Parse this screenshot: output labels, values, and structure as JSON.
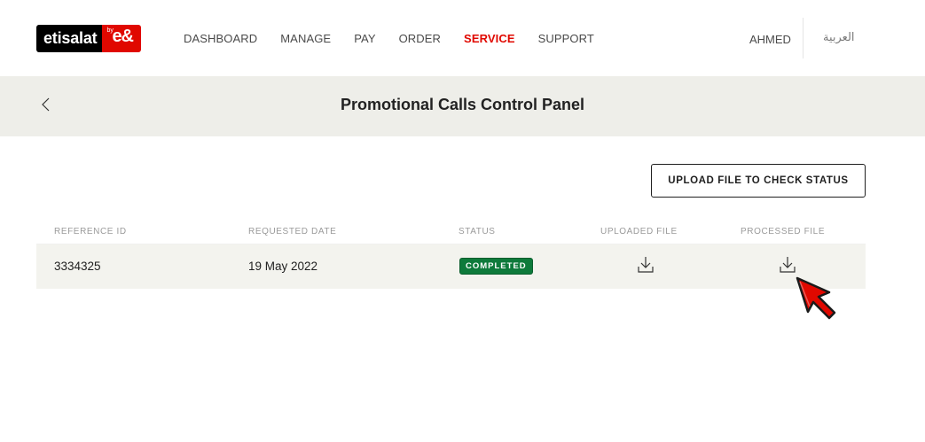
{
  "brand": {
    "name": "etisalat",
    "by": "by",
    "eand": "e&",
    "colors": {
      "red": "#e00800",
      "black": "#000000"
    }
  },
  "nav": {
    "items": [
      {
        "label": "DASHBOARD",
        "active": false
      },
      {
        "label": "MANAGE",
        "active": false
      },
      {
        "label": "PAY",
        "active": false
      },
      {
        "label": "ORDER",
        "active": false
      },
      {
        "label": "SERVICE",
        "active": true
      },
      {
        "label": "SUPPORT",
        "active": false
      }
    ],
    "user": "AHMED",
    "language": "العربية"
  },
  "page": {
    "title": "Promotional Calls Control Panel",
    "back_icon": "chevron-left-icon"
  },
  "actions": {
    "upload_label": "UPLOAD FILE TO CHECK STATUS"
  },
  "table": {
    "columns": [
      "REFERENCE ID",
      "REQUESTED DATE",
      "STATUS",
      "UPLOADED FILE",
      "PROCESSED FILE"
    ],
    "rows": [
      {
        "reference_id": "3334325",
        "requested_date": "19 May 2022",
        "status": "COMPLETED",
        "status_color": "#0e7a3b",
        "uploaded_file_icon": "download-icon",
        "processed_file_icon": "download-icon"
      }
    ]
  },
  "pointer": {
    "icon": "mouse-pointer-icon",
    "color": "#e00800"
  }
}
